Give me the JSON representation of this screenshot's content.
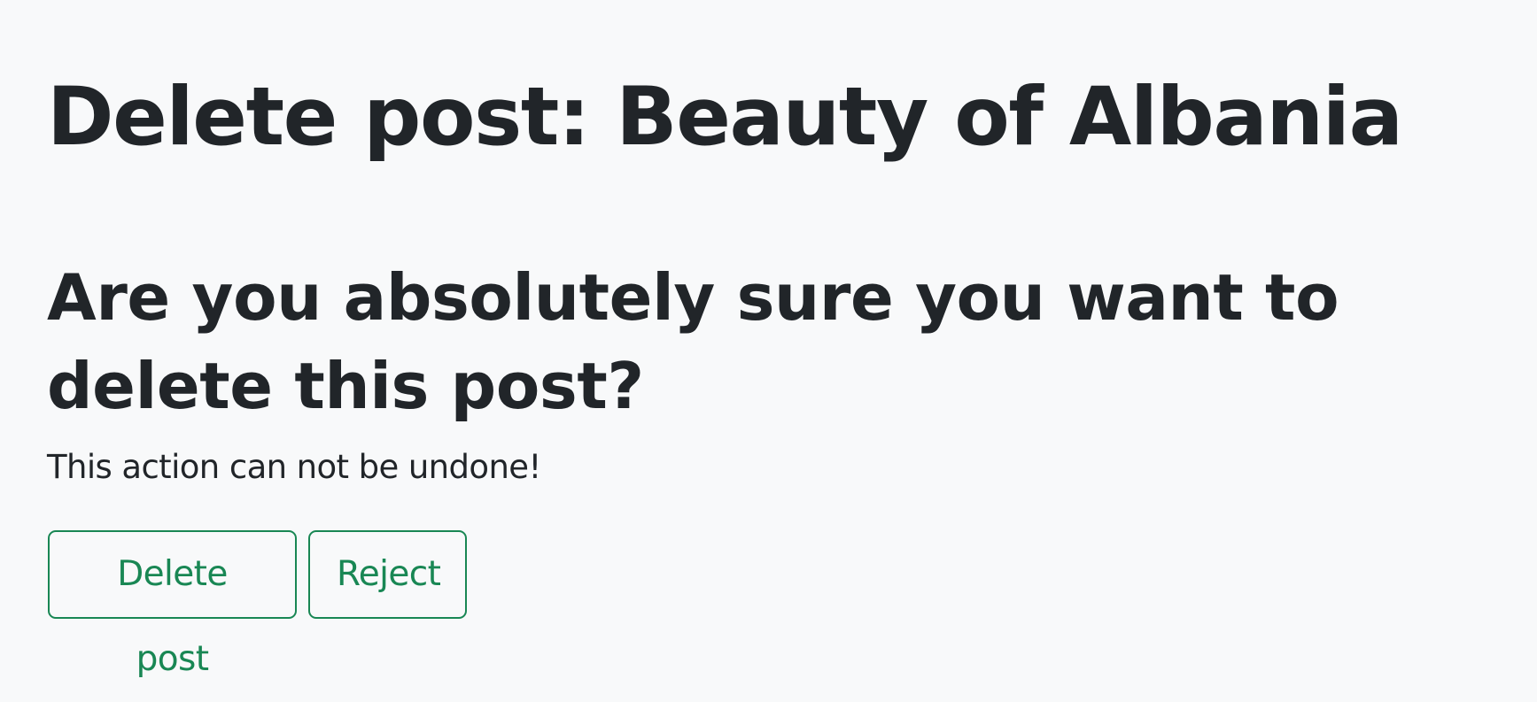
{
  "page": {
    "title": "Delete post: Beauty of Albania",
    "confirmation_heading": "Are you absolutely sure you want to delete this post?",
    "warning_text": "This action can not be undone!"
  },
  "actions": {
    "delete_label": "Delete post",
    "reject_label": "Reject"
  },
  "colors": {
    "background": "#f8f9fa",
    "text": "#212529",
    "button_accent": "#198754"
  }
}
